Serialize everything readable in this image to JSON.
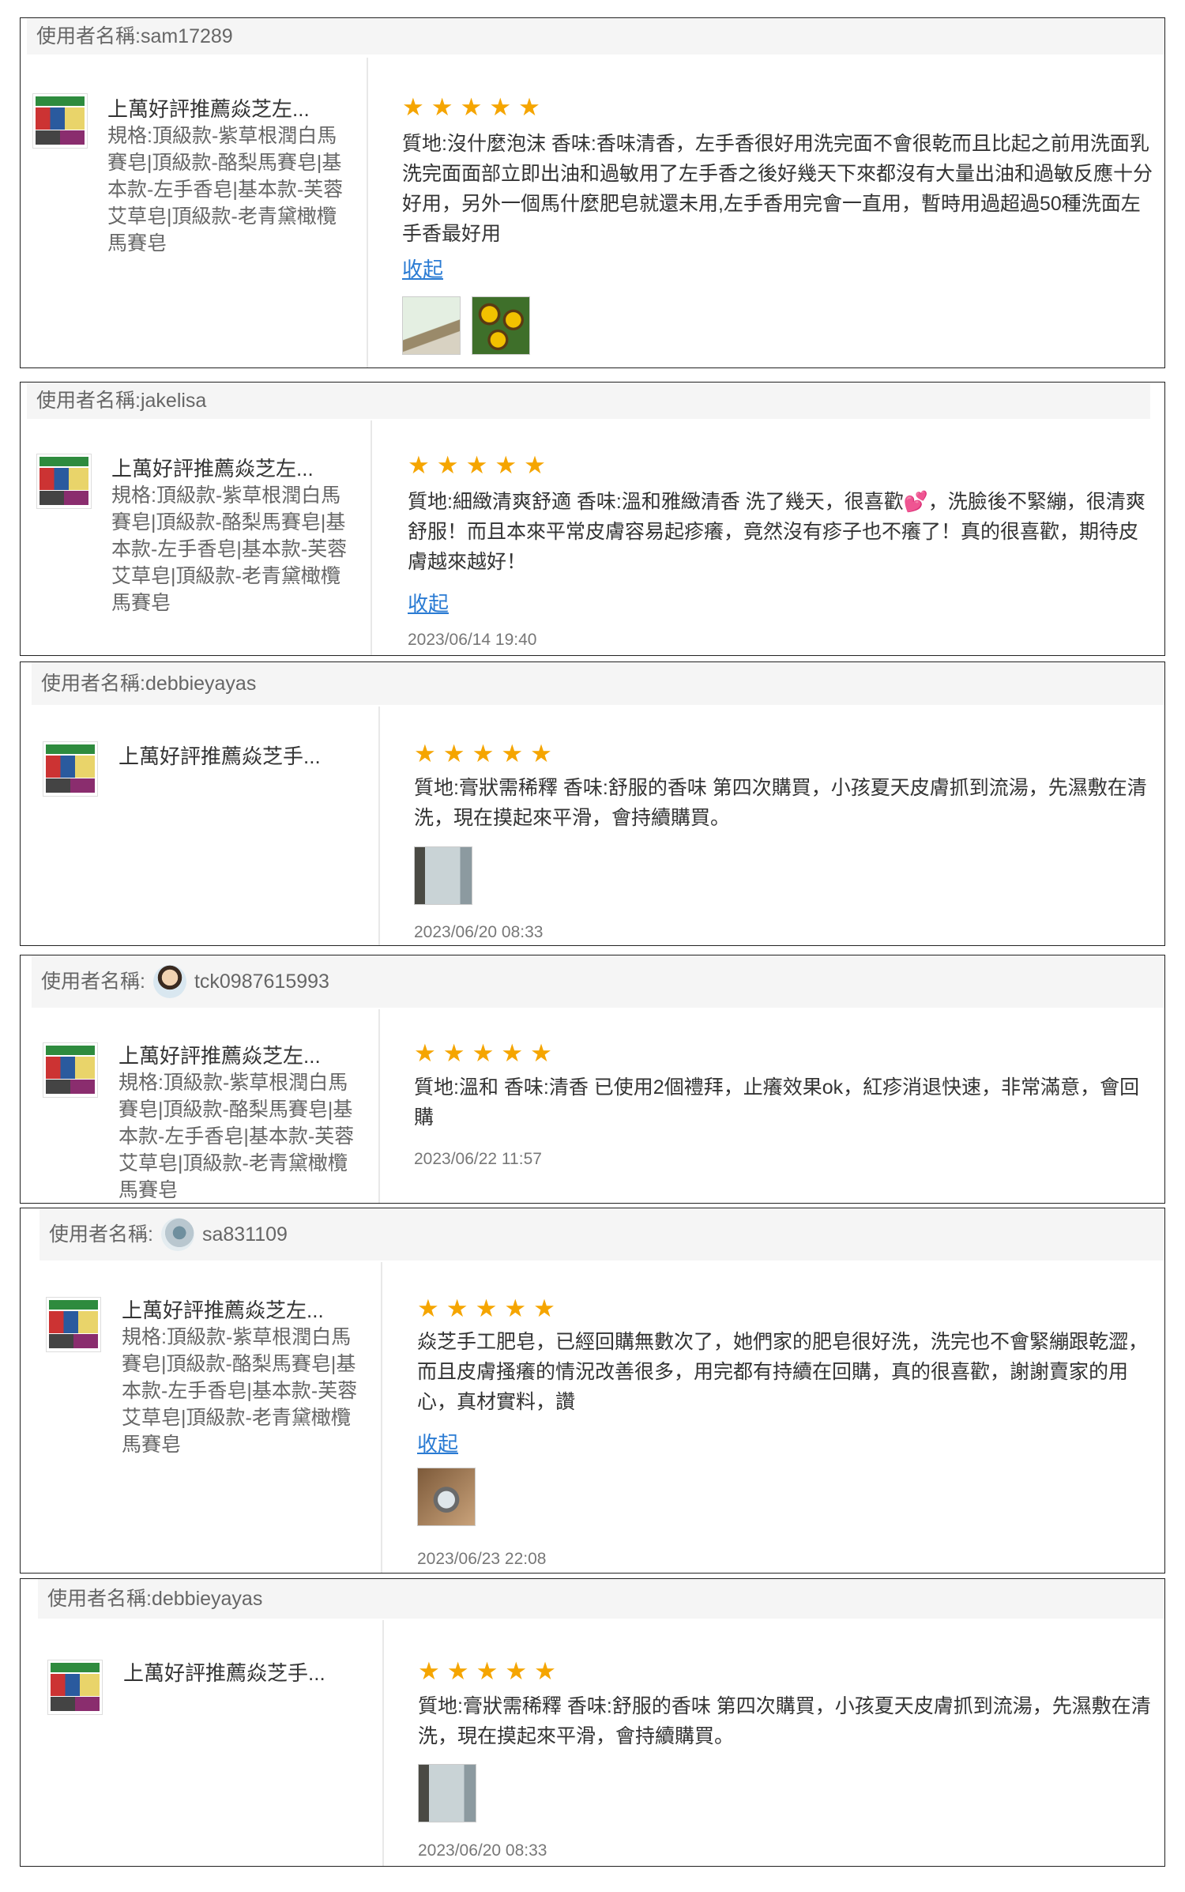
{
  "reviews": [
    {
      "user_label": "使用者名稱:",
      "username": "sam17289",
      "product_name": "上萬好評推薦焱芝左...",
      "spec": "規格:頂級款-紫草根潤白馬賽皂|頂級款-酪梨馬賽皂|基本款-左手香皂|基本款-芙蓉艾草皂|頂級款-老青黛橄欖馬賽皂",
      "rating": 5,
      "stars": "★★★★★",
      "comment": "質地:沒什麼泡沫 香味:香味清香，左手香很好用洗完面不會很乾而且比起之前用洗面乳洗完面面部立即出油和過敏用了左手香之後好幾天下來都沒有大量出油和過敏反應十分好用，另外一個馬什麼肥皂就還未用,左手香用完會一直用，暫時用過超過50種洗面左手香最好用",
      "collapse_label": "收起",
      "date": ""
    },
    {
      "user_label": "使用者名稱:",
      "username": "jakelisa",
      "product_name": "上萬好評推薦焱芝左...",
      "spec": "規格:頂級款-紫草根潤白馬賽皂|頂級款-酪梨馬賽皂|基本款-左手香皂|基本款-芙蓉艾草皂|頂級款-老青黛橄欖馬賽皂",
      "rating": 5,
      "stars": "★★★★★",
      "comment": "質地:細緻清爽舒適 香味:溫和雅緻清香 洗了幾天，很喜歡💕，洗臉後不緊繃，很清爽舒服！而且本來平常皮膚容易起疹癢，竟然沒有疹子也不癢了！真的很喜歡，期待皮膚越來越好！",
      "collapse_label": "收起",
      "date": "2023/06/14 19:40"
    },
    {
      "user_label": "使用者名稱:",
      "username": "debbieyayas",
      "product_name": "上萬好評推薦焱芝手...",
      "spec": "",
      "rating": 5,
      "stars": "★★★★★",
      "comment": "質地:膏狀需稀釋 香味:舒服的香味 第四次購買，小孩夏天皮膚抓到流湯，先濕敷在清洗，現在摸起來平滑，會持續購買。",
      "collapse_label": "",
      "date": "2023/06/20 08:33"
    },
    {
      "user_label": "使用者名稱:",
      "username": "tck0987615993",
      "product_name": "上萬好評推薦焱芝左...",
      "spec": "規格:頂級款-紫草根潤白馬賽皂|頂級款-酪梨馬賽皂|基本款-左手香皂|基本款-芙蓉艾草皂|頂級款-老青黛橄欖馬賽皂",
      "rating": 5,
      "stars": "★★★★★",
      "comment": "質地:溫和 香味:清香 已使用2個禮拜，止癢效果ok，紅疹消退快速，非常滿意，會回購",
      "collapse_label": "",
      "date": "2023/06/22 11:57"
    },
    {
      "user_label": "使用者名稱:",
      "username": "sa831109",
      "product_name": "上萬好評推薦焱芝左...",
      "spec": "規格:頂級款-紫草根潤白馬賽皂|頂級款-酪梨馬賽皂|基本款-左手香皂|基本款-芙蓉艾草皂|頂級款-老青黛橄欖馬賽皂",
      "rating": 5,
      "stars": "★★★★★",
      "comment": "焱芝手工肥皂，已經回購無數次了，她們家的肥皂很好洗，洗完也不會緊繃跟乾澀，而且皮膚搔癢的情況改善很多，用完都有持續在回購，真的很喜歡，謝謝賣家的用心，真材實料，讚",
      "collapse_label": "收起",
      "date": "2023/06/23 22:08"
    },
    {
      "user_label": "使用者名稱:",
      "username": "debbieyayas",
      "product_name": "上萬好評推薦焱芝手...",
      "spec": "",
      "rating": 5,
      "stars": "★★★★★",
      "comment": "質地:膏狀需稀釋 香味:舒服的香味 第四次購買，小孩夏天皮膚抓到流湯，先濕敷在清洗，現在摸起來平滑，會持續購買。",
      "collapse_label": "",
      "date": "2023/06/20 08:33"
    }
  ]
}
